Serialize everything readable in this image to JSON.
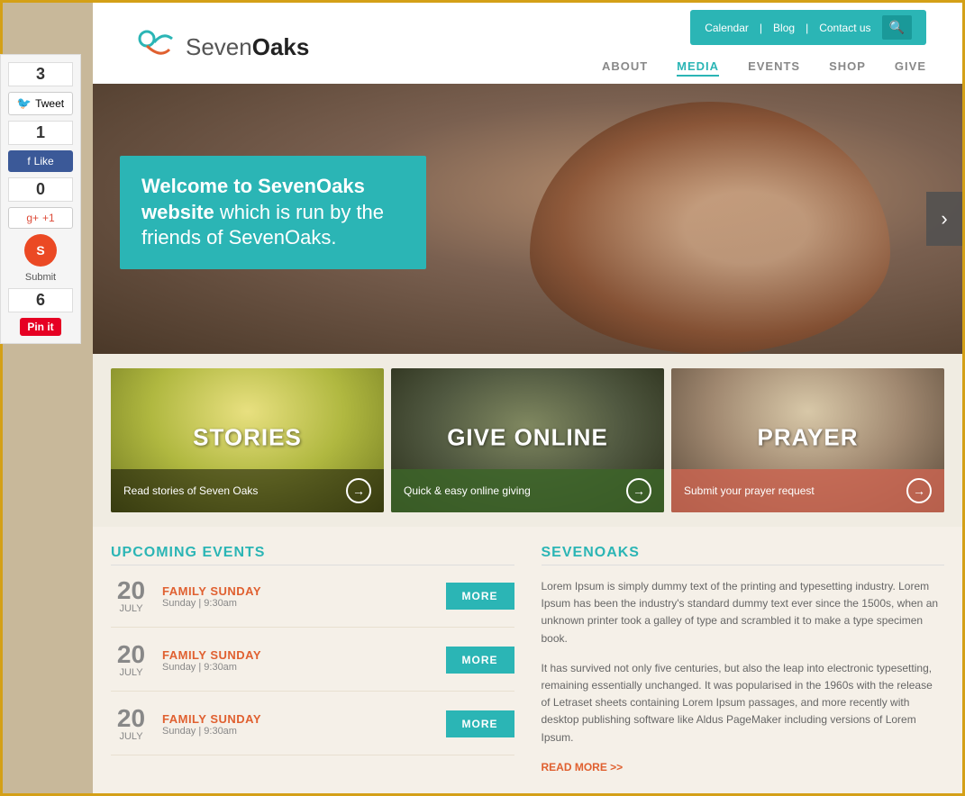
{
  "sidebar": {
    "tweet_count": "3",
    "tweet_label": "Tweet",
    "like_count": "1",
    "like_label": "Like",
    "gplus_count": "0",
    "gplus_label": "+1",
    "submit_count": "6",
    "submit_label": "Submit",
    "pin_label": "Pin it"
  },
  "header": {
    "top_nav": {
      "calendar": "Calendar",
      "blog": "Blog",
      "contact": "Contact us"
    },
    "logo": {
      "seven": "Seven",
      "oaks": "Oaks"
    },
    "nav": [
      {
        "label": "ABOUT",
        "active": false
      },
      {
        "label": "MEDIA",
        "active": true
      },
      {
        "label": "EVENTS",
        "active": false
      },
      {
        "label": "SHOP",
        "active": false
      },
      {
        "label": "GIVE",
        "active": false
      }
    ]
  },
  "hero": {
    "title": "Welcome to SevenOaks",
    "bold": "website",
    "subtitle": " which is run by the friends of SevenOaks."
  },
  "cards": [
    {
      "title": "STORIES",
      "footer": "Read stories of Seven Oaks",
      "type": "stories"
    },
    {
      "title": "GIVE ONLINE",
      "footer": "Quick & easy online giving",
      "type": "give"
    },
    {
      "title": "PRAYER",
      "footer": "Submit your prayer request",
      "type": "prayer"
    }
  ],
  "events": {
    "section_title": "UPCOMING EVENTS",
    "items": [
      {
        "day": "20",
        "month": "JULY",
        "name": "FAMILY SUNDAY",
        "schedule": "Sunday | 9:30am"
      },
      {
        "day": "20",
        "month": "JULY",
        "name": "FAMILY SUNDAY",
        "schedule": "Sunday | 9:30am"
      },
      {
        "day": "20",
        "month": "JULY",
        "name": "FAMILY SUNDAY",
        "schedule": "Sunday | 9:30am"
      }
    ],
    "more_label": "MORE"
  },
  "sevenoaks": {
    "section_title": "SEVENOAKS",
    "para1": "Lorem Ipsum is simply dummy text of the printing and typesetting industry. Lorem Ipsum has been the industry's standard dummy text ever since the 1500s, when an unknown printer took a galley of type and scrambled it to make a type specimen book.",
    "para2": "It has survived not only five centuries, but also the leap into electronic typesetting, remaining essentially unchanged. It was popularised in the 1960s with the release of Letraset sheets containing Lorem Ipsum passages, and more recently with desktop publishing software like Aldus PageMaker including versions of Lorem Ipsum.",
    "read_more": "READ MORE >>"
  }
}
